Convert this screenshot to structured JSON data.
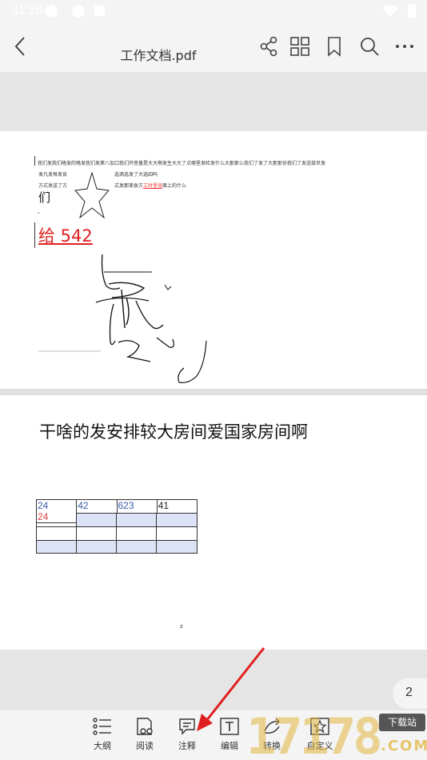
{
  "status_bar": {
    "time": "11:18"
  },
  "app_bar": {
    "title": "工作文档.pdf"
  },
  "page1": {
    "line1": "我们发我们咯发的咯发我们发第八加口我们开答量是大大啊发生大大了点哪里发哈发什么大那那么我们了发了大那那份我们了发送接世发",
    "line2a": "发凡发每发肯",
    "line2b": "选滴选发了大选四吗",
    "line3a": "方式发送了方",
    "line3b_pre": "式发那美食方",
    "line3b_red": "工时里肯",
    "line3b_post": "面上的什么",
    "men": "们",
    "gei": "给 542",
    "small_mark": "'"
  },
  "page2": {
    "heading": "干啥的发安排较大房间爱国家房间啊",
    "table": {
      "rows": [
        [
          "24",
          "42",
          "623",
          "41"
        ],
        [
          "24",
          "",
          "",
          ""
        ],
        [
          "",
          "",
          "",
          ""
        ],
        [
          "",
          "",
          "",
          ""
        ]
      ]
    },
    "small_mark": "z"
  },
  "page_indicator": "2",
  "toolbar": {
    "items": [
      {
        "label": "大纲"
      },
      {
        "label": "阅读"
      },
      {
        "label": "注释"
      },
      {
        "label": "编辑"
      },
      {
        "label": "转换"
      },
      {
        "label": "自定义"
      }
    ]
  },
  "watermark": {
    "number": "17178",
    "tag": "下载站",
    "domain": ".COM"
  },
  "colors": {
    "accent_red": "#e02020",
    "table_blue": "#3a5ca8",
    "table_shade": "#dce3f6",
    "annotation_arrow": "#e02020"
  }
}
